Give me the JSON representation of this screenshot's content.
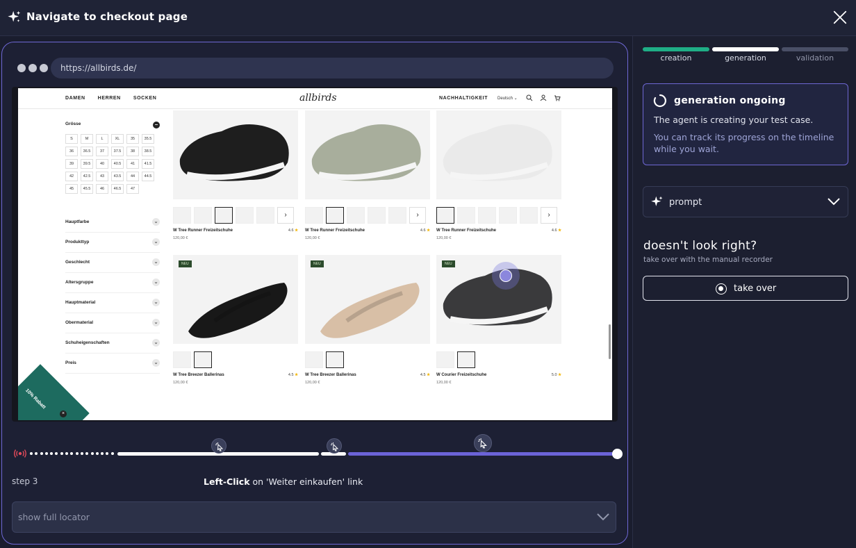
{
  "header": {
    "title": "Navigate to checkout page"
  },
  "browser": {
    "url": "https://allbirds.de/"
  },
  "site": {
    "nav_left": [
      "DAMEN",
      "HERREN",
      "SOCKEN"
    ],
    "logo": "allbirds",
    "nav_right": "NACHHALTIGKEIT",
    "language": "Deutsch",
    "filters": {
      "size_title": "Grösse",
      "sizes": [
        "S",
        "M",
        "L",
        "XL",
        "35",
        "35.5",
        "36",
        "36.5",
        "37",
        "37.5",
        "38",
        "38.5",
        "39",
        "39.5",
        "40",
        "40.5",
        "41",
        "41.5",
        "42",
        "42.5",
        "43",
        "43.5",
        "44",
        "44.5",
        "45",
        "45.5",
        "46",
        "46.5",
        "47"
      ],
      "facets": [
        "Hauptfarbe",
        "Produkttyp",
        "Geschlecht",
        "Altersgruppe",
        "Hauptmaterial",
        "Obermaterial",
        "Schuheigenschaften",
        "Preis"
      ]
    },
    "products": [
      {
        "name": "W Tree Runner Freizeitschuhe",
        "price": "120,00 €",
        "rating": "4.6",
        "badge": ""
      },
      {
        "name": "W Tree Runner Freizeitschuhe",
        "price": "120,00 €",
        "rating": "4.6",
        "badge": ""
      },
      {
        "name": "W Tree Runner Freizeitschuhe",
        "price": "120,00 €",
        "rating": "4.6",
        "badge": ""
      },
      {
        "name": "W Tree Breezer Ballerinas",
        "price": "120,00 €",
        "rating": "4.5",
        "badge": "NEU"
      },
      {
        "name": "W Tree Breezer Ballerinas",
        "price": "120,00 €",
        "rating": "4.5",
        "badge": "NEU"
      },
      {
        "name": "W Courier Freizeitschuhe",
        "price": "120,00 €",
        "rating": "5.0",
        "badge": "NEU"
      }
    ],
    "promo": "10% Rabatt"
  },
  "timeline": {
    "step_label": "step 3",
    "action_verb": "Left-Click",
    "action_rest": " on 'Weiter einkaufen' link",
    "locator_label": "show full locator",
    "accent": "#6b63d8"
  },
  "sidebar": {
    "stages": [
      {
        "label": "creation",
        "color": "#1fae86"
      },
      {
        "label": "generation",
        "color": "#ffffff"
      },
      {
        "label": "validation",
        "color": "#4a4f66"
      }
    ],
    "status_title": "generation ongoing",
    "status_line1": "The agent is creating your test case.",
    "status_line2": "You can track its progress on the timeline while you wait.",
    "prompt_label": "prompt",
    "help_title": "doesn't look right?",
    "help_sub": "take over with the manual recorder",
    "takeover_label": "take over"
  }
}
